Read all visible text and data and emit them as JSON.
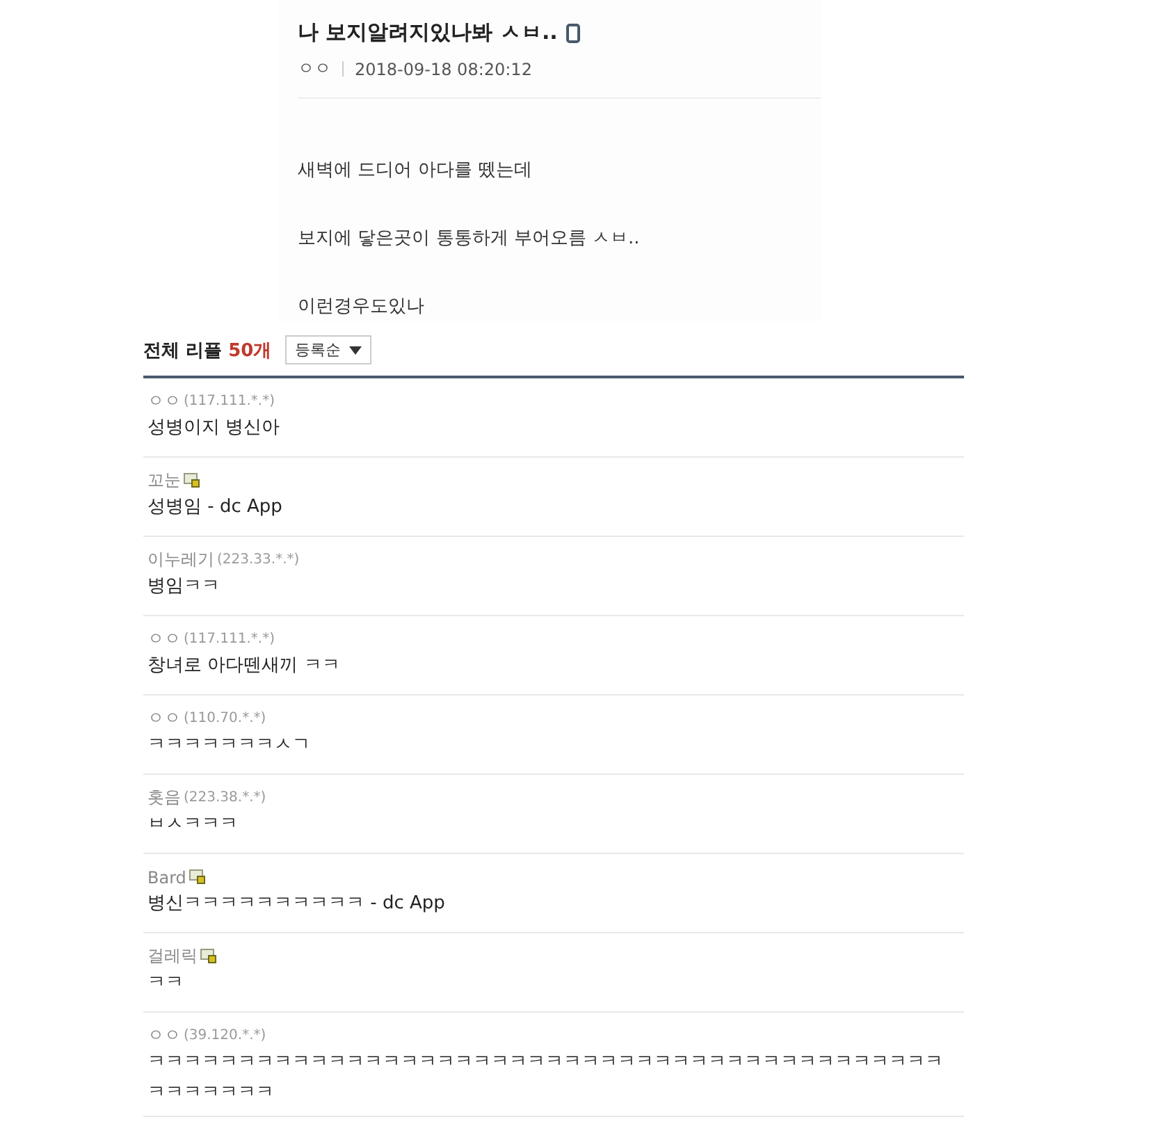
{
  "post": {
    "title": "나 보지알려지있나봐 ㅅㅂ..",
    "mobile": true,
    "author": "ㅇㅇ",
    "date": "2018-09-18 08:20:12",
    "body": [
      "새벽에 드디어 아다를 뗐는데",
      "보지에 닿은곳이 통통하게 부어오름 ㅅㅂ..",
      "이런경우도있나"
    ]
  },
  "replies_header": {
    "label": "전체 리플",
    "count": "50개",
    "sort": "등록순"
  },
  "replies": [
    {
      "kind": "guest",
      "author": "ㅇㅇ",
      "ip": "(117.111.*.*)",
      "text": "성병이지 병신아"
    },
    {
      "kind": "member",
      "author": "꼬눈",
      "text": "성병임 - dc App"
    },
    {
      "kind": "guest",
      "author": "이누레기",
      "ip": "(223.33.*.*)",
      "text": "병임ㅋㅋ"
    },
    {
      "kind": "guest",
      "author": "ㅇㅇ",
      "ip": "(117.111.*.*)",
      "text": "창녀로 아다뗀새끼 ㅋㅋ"
    },
    {
      "kind": "guest",
      "author": "ㅇㅇ",
      "ip": "(110.70.*.*)",
      "text": "ㅋㅋㅋㅋㅋㅋㅋㅅㄱ"
    },
    {
      "kind": "guest",
      "author": "홋음",
      "ip": "(223.38.*.*)",
      "text": "ㅂㅅㅋㅋㅋ"
    },
    {
      "kind": "member",
      "author": "Bard",
      "text": "병신ㅋㅋㅋㅋㅋㅋㅋㅋㅋㅋ - dc App"
    },
    {
      "kind": "member",
      "author": "걸레릭",
      "text": "ㅋㅋ"
    },
    {
      "kind": "guest",
      "author": "ㅇㅇ",
      "ip": "(39.120.*.*)",
      "text": "ㅋㅋㅋㅋㅋㅋㅋㅋㅋㅋㅋㅋㅋㅋㅋㅋㅋㅋㅋㅋㅋㅋㅋㅋㅋㅋㅋㅋㅋㅋㅋㅋㅋㅋㅋㅋㅋㅋㅋㅋㅋㅋㅋㅋㅋㅋㅋㅋㅋㅋㅋ"
    }
  ]
}
